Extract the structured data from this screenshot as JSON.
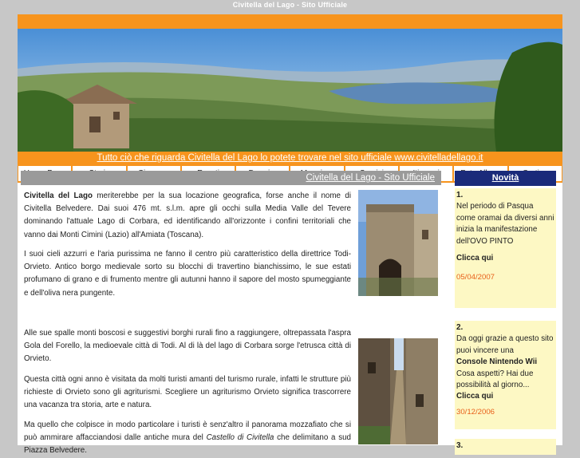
{
  "page": {
    "window_title": "Civitella del Lago - Sito Ufficiale"
  },
  "banner": {
    "tagline": "Tutto ciò che riguarda Civitella del Lago lo potete trovare nel sito ufficiale www.civitelladellago.it"
  },
  "nav": {
    "items": [
      "Home Page",
      "Storia",
      "Cicerone",
      "Eventi",
      "Dormire",
      "Mangiare",
      "Servizi",
      "Itinerari",
      "Foto Album",
      "Cartina"
    ]
  },
  "main": {
    "header": "Civitella del Lago - Sito Ufficiale",
    "p1_bold": "Civitella del Lago",
    "p1_rest": " meriterebbe per la sua locazione geografica, forse anche il nome di Civitella Belvedere. Dai suoi 476 mt. s.l.m. apre gli occhi sulla Media Valle del Tevere dominando l'attuale Lago di Corbara, ed identificando all'orizzonte i confini territoriali che vanno dai Monti Cimini (Lazio) all'Amiata (Toscana).",
    "p2": "I suoi cieli azzurri e l'aria purissima ne fanno il centro più caratteristico della direttrice Todi-Orvieto. Antico borgo medievale sorto su blocchi di travertino bianchissimo, le sue estati profumano di grano e di frumento mentre gli autunni hanno il sapore del mosto spumeggiante e dell'oliva nera pungente.",
    "p3": "Alle sue spalle monti boscosi e suggestivi borghi rurali fino a raggiungere, oltrepassata l'aspra Gola del Forello, la medioevale città di Todi. Al di là del lago di Corbara sorge l'etrusca città di Orvieto.",
    "p4": "Questa città ogni anno è visitata da molti turisti amanti del turismo rurale, infatti le strutture più richieste di Orvieto sono gli agriturismi. Scegliere un agriturismo Orvieto significa trascorrere una vacanza tra storia, arte e natura.",
    "p5_a": "Ma quello che colpisce in modo particolare i turisti è senz'altro il panorama mozzafiato che si può ammirare affacciandosi dalle antiche mura del ",
    "p5_italic": "Castello di Civitella",
    "p5_b": " che delimitano a sud Piazza Belvedere."
  },
  "sidebar": {
    "title": "Novità",
    "news": [
      {
        "num": "1.",
        "text": "Nel periodo di Pasqua come oramai da diversi anni inizia la manifestazione dell'OVO PINTO",
        "link": "Clicca qui",
        "date": "05/04/2007"
      },
      {
        "num": "2.",
        "text_a": "Da oggi grazie a questo sito puoi vincere una",
        "text_bold": "Console Nintendo Wii",
        "text_b": "Cosa aspetti? Hai due possibilità al giorno...",
        "link": "Clicca qui",
        "date": "30/12/2006"
      },
      {
        "num": "3."
      }
    ]
  },
  "colors": {
    "accent_orange": "#f7941d",
    "news_header": "#1a2a7a",
    "news_bg": "#fdf8c4",
    "date": "#e8601a",
    "page_bg": "#c7c7c7"
  }
}
